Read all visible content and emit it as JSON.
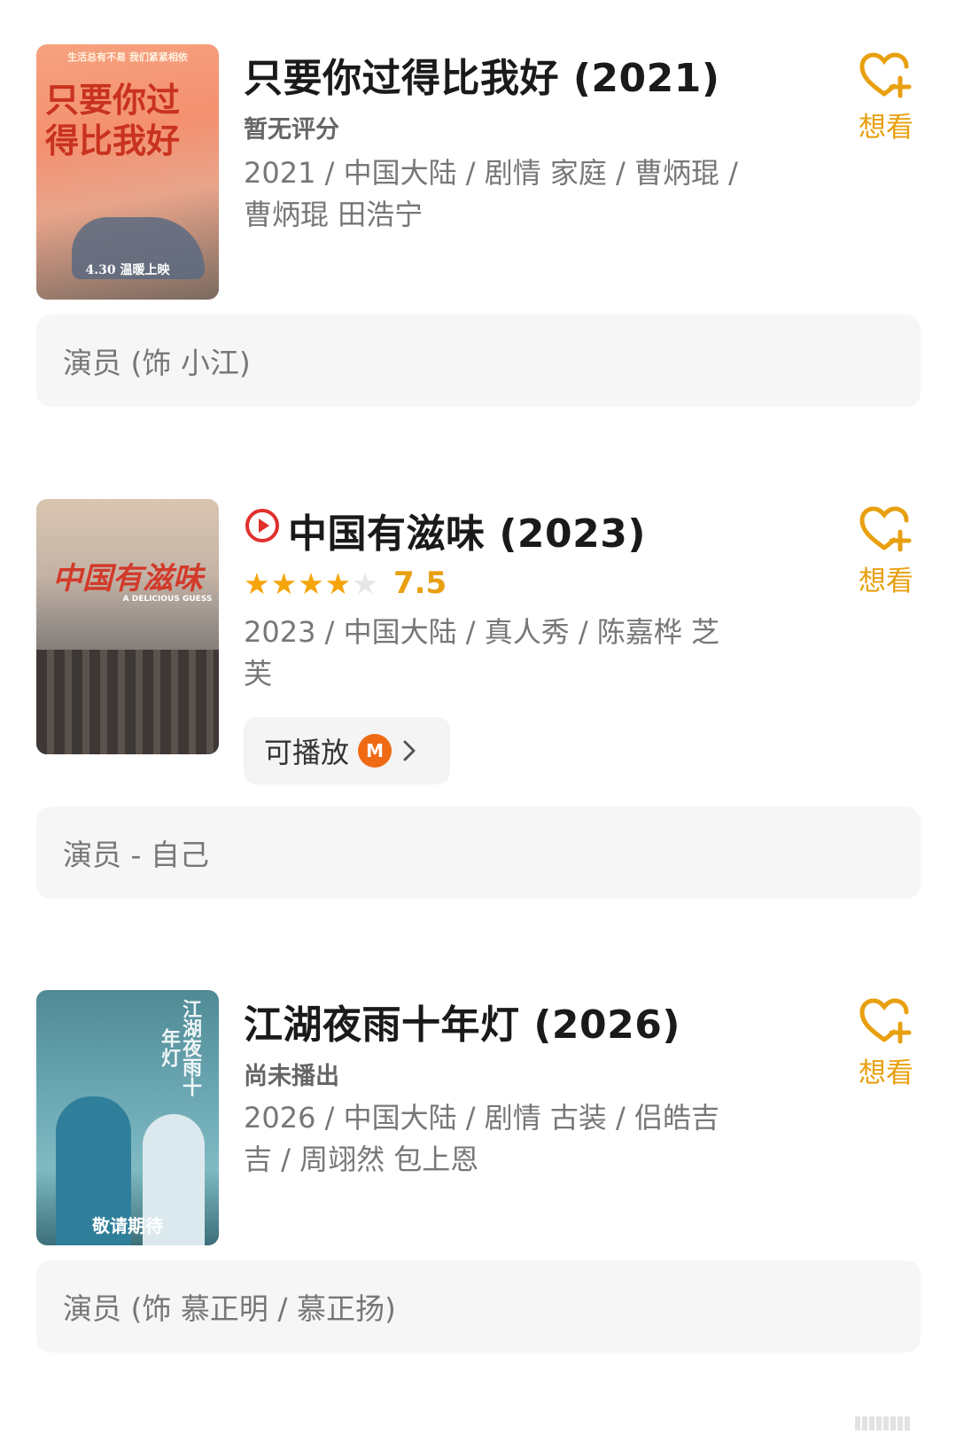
{
  "items": [
    {
      "poster_text": "只要你过得比我好",
      "poster_tagline": "生活总有不易 我们紧紧相依",
      "poster_date": "4.30 温暖上映",
      "title": "只要你过得比我好 (2021)",
      "rating_text": "暂无评分",
      "meta": "2021 / 中国大陆 / 剧情 家庭 / 曹炳琨 / 曹炳琨 田浩宁",
      "role": "演员 (饰 小江)",
      "want_label": "想看"
    },
    {
      "poster_text": "中国有滋味",
      "poster_subtitle": "A DELICIOUS GUESS",
      "title": "中国有滋味 (2023)",
      "stars_filled": 4,
      "stars_total": 5,
      "rating": "7.5",
      "meta": "2023 / 中国大陆 / 真人秀 / 陈嘉桦 芝芙",
      "play_label": "可播放",
      "play_logo": "mango-tv-logo",
      "role": "演员 - 自己",
      "want_label": "想看"
    },
    {
      "poster_text": "江湖夜雨十年灯",
      "poster_badge": "敬请期待",
      "title": "江湖夜雨十年灯 (2026)",
      "rating_text": "尚未播出",
      "meta": "2026 / 中国大陆 / 剧情 古装 / 侣皓吉吉 / 周翊然 包上恩",
      "role": "演员 (饰 慕正明 / 慕正扬)",
      "want_label": "想看"
    }
  ],
  "colors": {
    "accent": "#e8a010",
    "play_red": "#e0302c",
    "star_filled": "#f5a40a",
    "star_empty": "#e6e6e6",
    "mango_orange": "#f06a14"
  },
  "icons": [
    "heart-plus-icon",
    "play-circle-icon",
    "star-icon",
    "chevron-right-icon"
  ]
}
